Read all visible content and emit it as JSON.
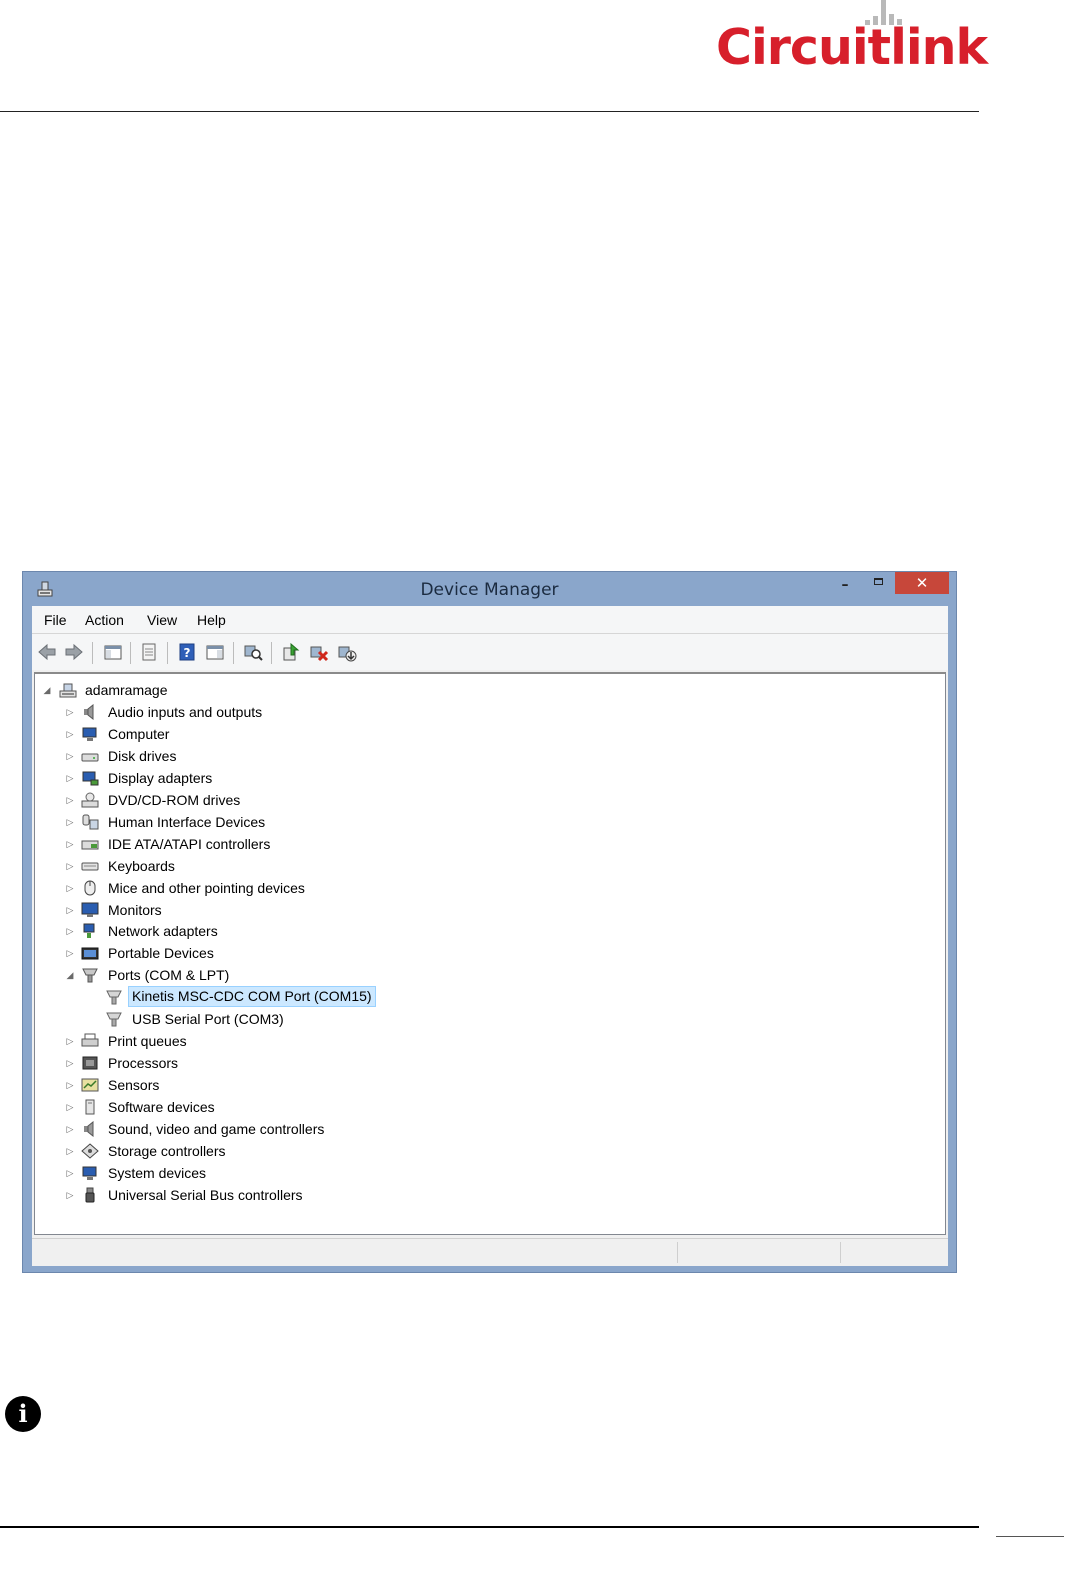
{
  "logo": {
    "text": "Circuitlink"
  },
  "window": {
    "title": "Device Manager",
    "controls": {
      "minimize": "–",
      "close": "✕"
    }
  },
  "menu": {
    "items": [
      "File",
      "Action",
      "View",
      "Help"
    ]
  },
  "toolbar": {
    "buttons": [
      "back-icon",
      "forward-icon",
      "show-hide-console-tree-icon",
      "properties-icon",
      "help-icon",
      "show-hide-action-pane-icon",
      "scan-hardware-icon",
      "update-driver-icon",
      "uninstall-device-icon",
      "enable-device-icon"
    ]
  },
  "tree": {
    "root": "adamramage",
    "categories": [
      {
        "label": "Audio inputs and outputs",
        "icon": "speaker-icon"
      },
      {
        "label": "Computer",
        "icon": "computer-icon"
      },
      {
        "label": "Disk drives",
        "icon": "disk-drive-icon"
      },
      {
        "label": "Display adapters",
        "icon": "display-adapter-icon"
      },
      {
        "label": "DVD/CD-ROM drives",
        "icon": "dvd-drive-icon"
      },
      {
        "label": "Human Interface Devices",
        "icon": "hid-icon"
      },
      {
        "label": "IDE ATA/ATAPI controllers",
        "icon": "ide-controller-icon"
      },
      {
        "label": "Keyboards",
        "icon": "keyboard-icon"
      },
      {
        "label": "Mice and other pointing devices",
        "icon": "mouse-icon"
      },
      {
        "label": "Monitors",
        "icon": "monitor-icon"
      },
      {
        "label": "Network adapters",
        "icon": "network-adapter-icon"
      },
      {
        "label": "Portable Devices",
        "icon": "portable-device-icon"
      },
      {
        "label": "Ports (COM & LPT)",
        "icon": "port-icon",
        "expanded": true,
        "children": [
          {
            "label": "Kinetis MSC-CDC COM Port (COM15)",
            "selected": true
          },
          {
            "label": "USB Serial Port (COM3)"
          }
        ]
      },
      {
        "label": "Print queues",
        "icon": "printer-icon"
      },
      {
        "label": "Processors",
        "icon": "processor-icon"
      },
      {
        "label": "Sensors",
        "icon": "sensor-icon"
      },
      {
        "label": "Software devices",
        "icon": "software-device-icon"
      },
      {
        "label": "Sound, video and game controllers",
        "icon": "speaker-icon"
      },
      {
        "label": "Storage controllers",
        "icon": "storage-controller-icon"
      },
      {
        "label": "System devices",
        "icon": "system-device-icon"
      },
      {
        "label": "Universal Serial Bus controllers",
        "icon": "usb-icon"
      }
    ]
  },
  "colors": {
    "brand": "#d71f2b",
    "window_frame": "#8aa6cb",
    "close_button": "#c7473a",
    "selection": "#cce8ff"
  }
}
